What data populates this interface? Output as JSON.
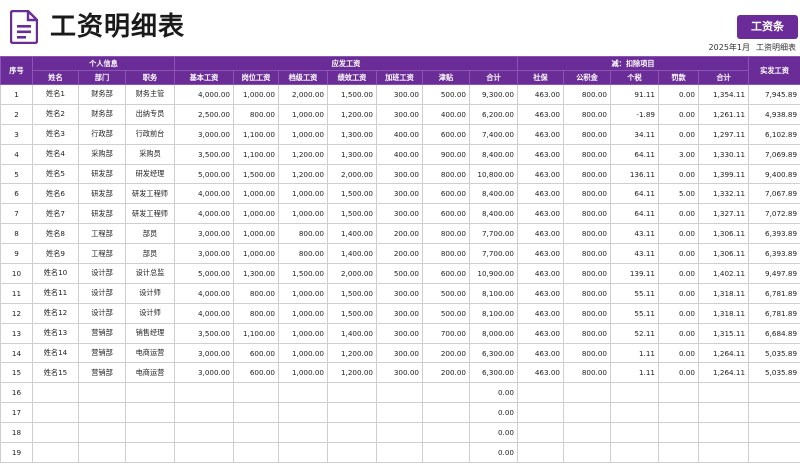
{
  "title": "工资明细表",
  "payslip_button": "工资条",
  "period": "2025年1月",
  "subtitle": "工资明细表",
  "headers": {
    "seq": "序号",
    "group_personal": "个人信息",
    "group_gross": "应发工资",
    "group_deduct": "减：扣除项目",
    "net": "实发工资",
    "name": "姓名",
    "dept": "部门",
    "position": "职务",
    "base": "基本工资",
    "post": "岗位工资",
    "grade": "档级工资",
    "perf": "绩效工资",
    "overtime": "加班工资",
    "allowance": "津贴",
    "gross_total": "合计",
    "social": "社保",
    "fund": "公积金",
    "tax": "个税",
    "fine": "罚款",
    "deduct_total": "合计"
  },
  "rows": [
    [
      "1",
      "姓名1",
      "财务部",
      "财务主管",
      "4,000.00",
      "1,000.00",
      "2,000.00",
      "1,500.00",
      "300.00",
      "500.00",
      "9,300.00",
      "463.00",
      "800.00",
      "91.11",
      "0.00",
      "1,354.11",
      "7,945.89"
    ],
    [
      "2",
      "姓名2",
      "财务部",
      "出纳专员",
      "2,500.00",
      "800.00",
      "1,000.00",
      "1,200.00",
      "300.00",
      "400.00",
      "6,200.00",
      "463.00",
      "800.00",
      "-1.89",
      "0.00",
      "1,261.11",
      "4,938.89"
    ],
    [
      "3",
      "姓名3",
      "行政部",
      "行政前台",
      "3,000.00",
      "1,100.00",
      "1,000.00",
      "1,300.00",
      "400.00",
      "600.00",
      "7,400.00",
      "463.00",
      "800.00",
      "34.11",
      "0.00",
      "1,297.11",
      "6,102.89"
    ],
    [
      "4",
      "姓名4",
      "采购部",
      "采购员",
      "3,500.00",
      "1,100.00",
      "1,200.00",
      "1,300.00",
      "400.00",
      "900.00",
      "8,400.00",
      "463.00",
      "800.00",
      "64.11",
      "3.00",
      "1,330.11",
      "7,069.89"
    ],
    [
      "5",
      "姓名5",
      "研发部",
      "研发经理",
      "5,000.00",
      "1,500.00",
      "1,200.00",
      "2,000.00",
      "300.00",
      "800.00",
      "10,800.00",
      "463.00",
      "800.00",
      "136.11",
      "0.00",
      "1,399.11",
      "9,400.89"
    ],
    [
      "6",
      "姓名6",
      "研发部",
      "研发工程师",
      "4,000.00",
      "1,000.00",
      "1,000.00",
      "1,500.00",
      "300.00",
      "600.00",
      "8,400.00",
      "463.00",
      "800.00",
      "64.11",
      "5.00",
      "1,332.11",
      "7,067.89"
    ],
    [
      "7",
      "姓名7",
      "研发部",
      "研发工程师",
      "4,000.00",
      "1,000.00",
      "1,000.00",
      "1,500.00",
      "300.00",
      "600.00",
      "8,400.00",
      "463.00",
      "800.00",
      "64.11",
      "0.00",
      "1,327.11",
      "7,072.89"
    ],
    [
      "8",
      "姓名8",
      "工程部",
      "部员",
      "3,000.00",
      "1,000.00",
      "800.00",
      "1,400.00",
      "200.00",
      "800.00",
      "7,700.00",
      "463.00",
      "800.00",
      "43.11",
      "0.00",
      "1,306.11",
      "6,393.89"
    ],
    [
      "9",
      "姓名9",
      "工程部",
      "部员",
      "3,000.00",
      "1,000.00",
      "800.00",
      "1,400.00",
      "200.00",
      "800.00",
      "7,700.00",
      "463.00",
      "800.00",
      "43.11",
      "0.00",
      "1,306.11",
      "6,393.89"
    ],
    [
      "10",
      "姓名10",
      "设计部",
      "设计总监",
      "5,000.00",
      "1,300.00",
      "1,500.00",
      "2,000.00",
      "500.00",
      "600.00",
      "10,900.00",
      "463.00",
      "800.00",
      "139.11",
      "0.00",
      "1,402.11",
      "9,497.89"
    ],
    [
      "11",
      "姓名11",
      "设计部",
      "设计师",
      "4,000.00",
      "800.00",
      "1,000.00",
      "1,500.00",
      "300.00",
      "500.00",
      "8,100.00",
      "463.00",
      "800.00",
      "55.11",
      "0.00",
      "1,318.11",
      "6,781.89"
    ],
    [
      "12",
      "姓名12",
      "设计部",
      "设计师",
      "4,000.00",
      "800.00",
      "1,000.00",
      "1,500.00",
      "300.00",
      "500.00",
      "8,100.00",
      "463.00",
      "800.00",
      "55.11",
      "0.00",
      "1,318.11",
      "6,781.89"
    ],
    [
      "13",
      "姓名13",
      "营销部",
      "销售经理",
      "3,500.00",
      "1,100.00",
      "1,000.00",
      "1,400.00",
      "300.00",
      "700.00",
      "8,000.00",
      "463.00",
      "800.00",
      "52.11",
      "0.00",
      "1,315.11",
      "6,684.89"
    ],
    [
      "14",
      "姓名14",
      "营销部",
      "电商运营",
      "3,000.00",
      "600.00",
      "1,000.00",
      "1,200.00",
      "300.00",
      "200.00",
      "6,300.00",
      "463.00",
      "800.00",
      "1.11",
      "0.00",
      "1,264.11",
      "5,035.89"
    ],
    [
      "15",
      "姓名15",
      "营销部",
      "电商运营",
      "3,000.00",
      "600.00",
      "1,000.00",
      "1,200.00",
      "300.00",
      "200.00",
      "6,300.00",
      "463.00",
      "800.00",
      "1.11",
      "0.00",
      "1,264.11",
      "5,035.89"
    ],
    [
      "16",
      "",
      "",
      "",
      "",
      "",
      "",
      "",
      "",
      "",
      "0.00",
      "",
      "",
      "",
      "",
      "",
      ""
    ],
    [
      "17",
      "",
      "",
      "",
      "",
      "",
      "",
      "",
      "",
      "",
      "0.00",
      "",
      "",
      "",
      "",
      "",
      ""
    ],
    [
      "18",
      "",
      "",
      "",
      "",
      "",
      "",
      "",
      "",
      "",
      "0.00",
      "",
      "",
      "",
      "",
      "",
      ""
    ],
    [
      "19",
      "",
      "",
      "",
      "",
      "",
      "",
      "",
      "",
      "",
      "0.00",
      "",
      "",
      "",
      "",
      "",
      ""
    ]
  ],
  "colors": {
    "accent": "#6a2c97",
    "button": "#6b2c9a"
  },
  "icons": {
    "document": "document-icon"
  }
}
